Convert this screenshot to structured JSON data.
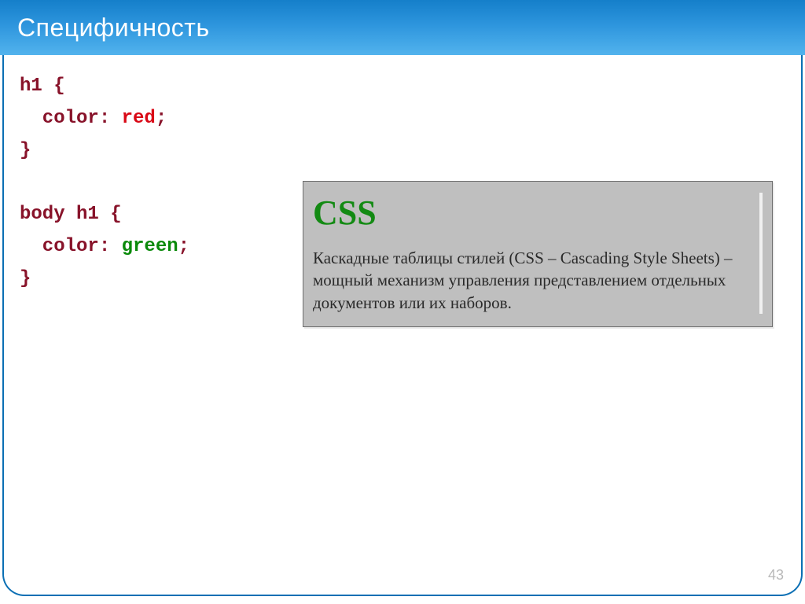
{
  "slide": {
    "title": "Специфичность",
    "page_number": "43"
  },
  "code": {
    "rule1_selector": "h1 ",
    "rule1_open": "{",
    "rule1_prop_indent": "  color: ",
    "rule1_value": "red",
    "rule1_semicolon": ";",
    "rule1_close": "}",
    "blank": " ",
    "rule2_selector": "body h1 ",
    "rule2_open": "{",
    "rule2_prop_indent": "  color: ",
    "rule2_value": "green",
    "rule2_semicolon": ";",
    "rule2_close": "}"
  },
  "preview": {
    "heading": "CSS",
    "paragraph": "Каскадные таблицы стилей (CSS – Cascading Style Sheets) – мощный механизм управления представлением отдельных документов или их наборов."
  }
}
